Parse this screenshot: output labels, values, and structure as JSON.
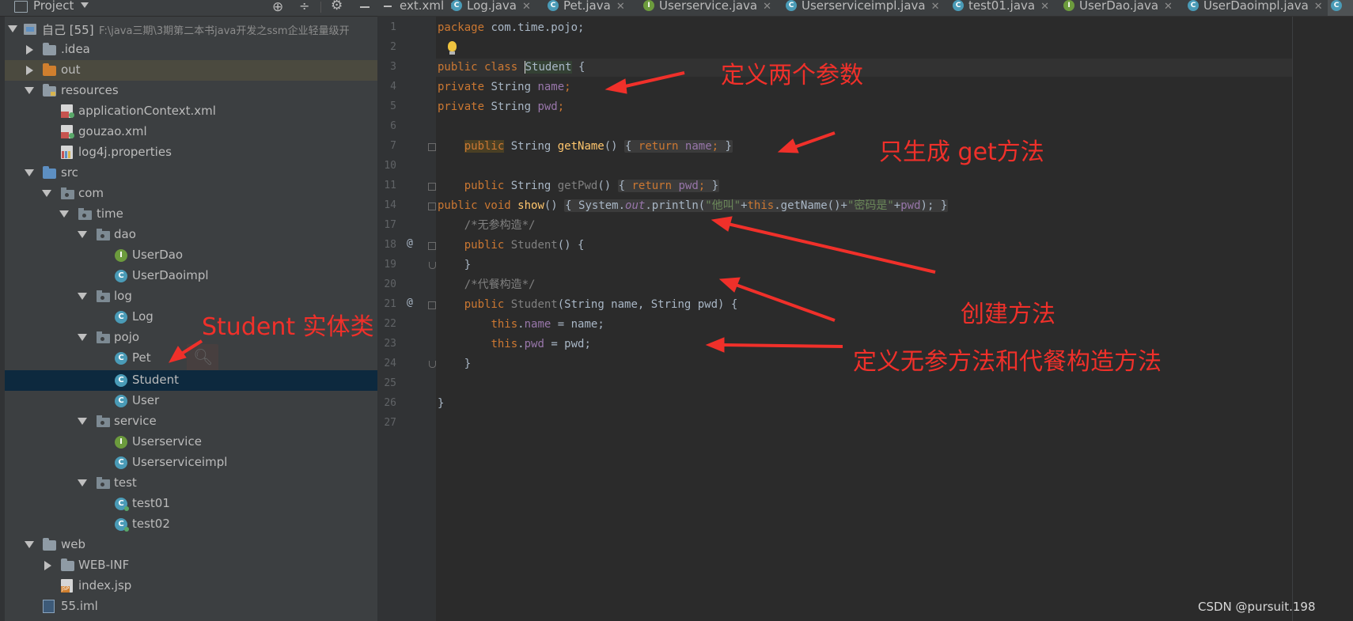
{
  "project_panel": {
    "title": "Project",
    "tree": [
      {
        "label": "自己 [55]",
        "path": "F:\\java三期\\3期第二本书java开发之ssm企业轻量级开",
        "icon": "module-folder-icon",
        "state": "open"
      },
      {
        "label": ".idea",
        "icon": "folder-icon",
        "state": "closed"
      },
      {
        "label": "out",
        "icon": "output-folder-icon",
        "state": "closed"
      },
      {
        "label": "resources",
        "icon": "resources-folder-icon",
        "state": "open"
      },
      {
        "label": "applicationContext.xml",
        "icon": "spring-xml-file-icon"
      },
      {
        "label": "gouzao.xml",
        "icon": "spring-xml-file-icon"
      },
      {
        "label": "log4j.properties",
        "icon": "properties-file-icon"
      },
      {
        "label": "src",
        "icon": "source-folder-icon",
        "state": "open"
      },
      {
        "label": "com",
        "icon": "package-icon",
        "state": "open"
      },
      {
        "label": "time",
        "icon": "package-icon",
        "state": "open"
      },
      {
        "label": "dao",
        "icon": "package-icon",
        "state": "open"
      },
      {
        "label": "UserDao",
        "icon": "interface-icon"
      },
      {
        "label": "UserDaoimpl",
        "icon": "class-icon"
      },
      {
        "label": "log",
        "icon": "package-icon",
        "state": "open"
      },
      {
        "label": "Log",
        "icon": "class-icon"
      },
      {
        "label": "pojo",
        "icon": "package-icon",
        "state": "open"
      },
      {
        "label": "Pet",
        "icon": "class-icon"
      },
      {
        "label": "Student",
        "icon": "class-icon",
        "selected": true
      },
      {
        "label": "User",
        "icon": "class-icon"
      },
      {
        "label": "service",
        "icon": "package-icon",
        "state": "open"
      },
      {
        "label": "Userservice",
        "icon": "interface-icon"
      },
      {
        "label": "Userserviceimpl",
        "icon": "class-icon"
      },
      {
        "label": "test",
        "icon": "package-icon",
        "state": "open"
      },
      {
        "label": "test01",
        "icon": "runnable-class-icon"
      },
      {
        "label": "test02",
        "icon": "runnable-class-icon"
      },
      {
        "label": "web",
        "icon": "web-folder-icon",
        "state": "open"
      },
      {
        "label": "WEB-INF",
        "icon": "folder-icon",
        "state": "closed"
      },
      {
        "label": "index.jsp",
        "icon": "jsp-file-icon"
      },
      {
        "label": "55.iml",
        "icon": "iml-file-icon"
      }
    ]
  },
  "tabs": [
    {
      "label": "ext.xml",
      "icon": "xml-file-icon"
    },
    {
      "label": "Log.java",
      "icon": "class-icon"
    },
    {
      "label": "Pet.java",
      "icon": "class-icon"
    },
    {
      "label": "Userservice.java",
      "icon": "interface-icon"
    },
    {
      "label": "Userserviceimpl.java",
      "icon": "class-icon"
    },
    {
      "label": "test01.java",
      "icon": "class-icon"
    },
    {
      "label": "UserDao.java",
      "icon": "interface-icon"
    },
    {
      "label": "UserDaoimpl.java",
      "icon": "class-icon"
    }
  ],
  "editor": {
    "line_numbers": [
      "1",
      "2",
      "3",
      "4",
      "5",
      "6",
      "7",
      "10",
      "11",
      "14",
      "17",
      "18",
      "19",
      "20",
      "21",
      "22",
      "23",
      "24",
      "25",
      "26",
      "27"
    ],
    "code": {
      "l1_kw": "package",
      "l1_rest": " com.time.pojo;",
      "l3_kw": "public class",
      "l3_name": "Student",
      "l3_rest": " {",
      "l4_kw": "private",
      "l4_type": " String ",
      "l4_field": "name",
      "l4_end": ";",
      "l5_kw": "private",
      "l5_type": " String ",
      "l5_field": "pwd",
      "l5_end": ";",
      "l7_kw": "public",
      "l7_type": " String ",
      "l7_method": "getName",
      "l7_paren": "() ",
      "l7_body_kw": "return",
      "l7_body_field": "name",
      "l11_kw": "public",
      "l11_type": " String ",
      "l11_method": "getPwd",
      "l11_paren": "() ",
      "l11_body_kw": "return",
      "l11_body_field": "pwd",
      "l14_kw": "public void",
      "l14_method": "show",
      "l14_paren": "() ",
      "l14_a": "System.",
      "l14_out": "out",
      "l14_b": ".println(",
      "l14_s1": "\"他叫\"",
      "l14_plus1": "+",
      "l14_this": "this",
      "l14_c": ".getName()+",
      "l14_s2": "\"密码是\"",
      "l14_d": "+",
      "l14_pwd": "pwd",
      "l14_e": ");",
      "l17_comment": "/*无参构造*/",
      "l18_kw": "public",
      "l18_name": "Student",
      "l18_rest": "() {",
      "l19": "}",
      "l20_comment": "/*代餐构造*/",
      "l21_kw": "public",
      "l21_name": "Student",
      "l21_rest": "(String name, String pwd) {",
      "l22_this": "this",
      "l22_field": "name",
      "l22_rest": " = name;",
      "l23_this": "this",
      "l23_field": "pwd",
      "l23_rest": " = pwd;",
      "l24": "}",
      "l26": "}"
    }
  },
  "annotations": {
    "params": "定义两个参数",
    "get_only": "只生成 get方法",
    "create_method": "创建方法",
    "constructors": "定义无参方法和代餐构造方法",
    "entity": "Student 实体类"
  },
  "watermark": "CSDN @pursuit.198",
  "colors": {
    "annotation": "#f0302a",
    "selection": "#0d293e",
    "keyword": "#cc7832",
    "field": "#9876aa",
    "method": "#ffc66d",
    "string": "#6a8759"
  }
}
